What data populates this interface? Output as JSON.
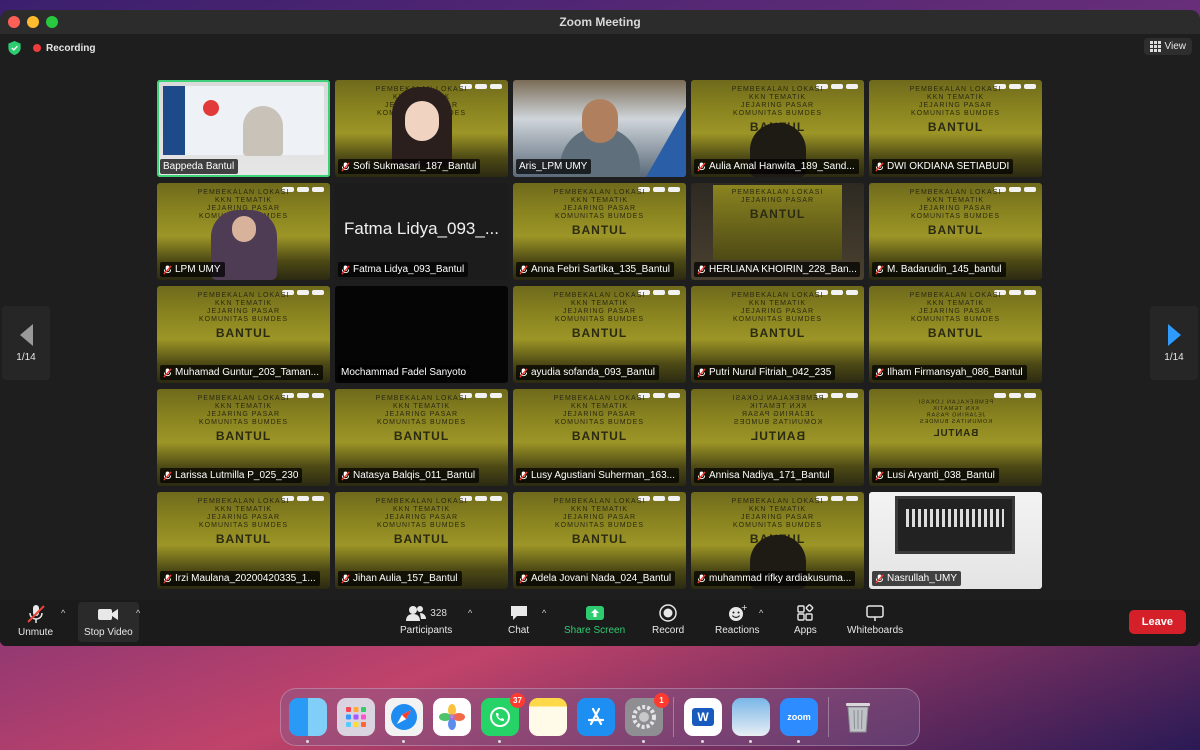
{
  "window": {
    "title": "Zoom Meeting"
  },
  "topbar": {
    "recording_label": "Recording",
    "view_label": "View"
  },
  "pagination": {
    "left": "1/14",
    "right": "1/14"
  },
  "tiles": [
    {
      "name": "Bappeda Bantul",
      "kind": "share",
      "active": true,
      "muted": false
    },
    {
      "name": "Sofi Sukmasari_187_Bantul",
      "kind": "person-slide",
      "muted": true
    },
    {
      "name": "Aris_LPM UMY",
      "kind": "person-b",
      "muted": false
    },
    {
      "name": "Aulia Amal Hanwita_189_Sand...",
      "kind": "person-slide-dark",
      "muted": true
    },
    {
      "name": "DWI OKDIANA SETIABUDI",
      "kind": "slide",
      "muted": true
    },
    {
      "name": "LPM UMY",
      "kind": "person-slide-hijab",
      "muted": true
    },
    {
      "name": "Fatma Lidya_093_Bantul",
      "kind": "blank",
      "bigname": "Fatma Lidya_093_...",
      "muted": true
    },
    {
      "name": "Anna Febri Sartika_135_Bantul",
      "kind": "slide",
      "muted": true
    },
    {
      "name": "HERLIANA KHOIRIN_228_Ban...",
      "kind": "photo-c",
      "muted": true
    },
    {
      "name": "M. Badarudin_145_bantul",
      "kind": "slide",
      "muted": true
    },
    {
      "name": "Muhamad Guntur_203_Taman...",
      "kind": "slide",
      "muted": true
    },
    {
      "name": "Mochammad Fadel Sanyoto",
      "kind": "black",
      "muted": false
    },
    {
      "name": "ayudia sofanda_093_Bantul",
      "kind": "slide",
      "muted": true
    },
    {
      "name": "Putri Nurul Fitriah_042_235",
      "kind": "slide",
      "muted": true
    },
    {
      "name": "Ilham Firmansyah_086_Bantul",
      "kind": "slide",
      "muted": true
    },
    {
      "name": "Larissa Lutmilla P_025_230",
      "kind": "slide",
      "muted": true
    },
    {
      "name": "Natasya Balqis_011_Bantul",
      "kind": "slide",
      "muted": true
    },
    {
      "name": "Lusy Agustiani Suherman_163...",
      "kind": "slide",
      "muted": true
    },
    {
      "name": "Annisa Nadiya_171_Bantul",
      "kind": "slide-mirror",
      "muted": true
    },
    {
      "name": "Lusi Aryanti_038_Bantul",
      "kind": "slide-mirror-small",
      "muted": true
    },
    {
      "name": "Irzi Maulana_20200420335_1...",
      "kind": "slide",
      "muted": true
    },
    {
      "name": "Jihan Aulia_157_Bantul",
      "kind": "slide",
      "muted": true
    },
    {
      "name": "Adela Jovani Nada_024_Bantul",
      "kind": "slide",
      "muted": true
    },
    {
      "name": "muhammad rifky ardiakusuma...",
      "kind": "person-slide-dark",
      "muted": true
    },
    {
      "name": "Nasrullah_UMY",
      "kind": "photo-d",
      "muted": true
    }
  ],
  "slide_text": {
    "line1": "PEMBEKALAN LOKASI",
    "line2": "KKN TEMATIK",
    "line3": "JEJARING PASAR",
    "line4": "KOMUNITAS BUMDES",
    "line5": "BANTUL"
  },
  "toolbar": {
    "unmute": "Unmute",
    "stop_video": "Stop Video",
    "participants": "Participants",
    "participants_count": "328",
    "chat": "Chat",
    "share_screen": "Share Screen",
    "record": "Record",
    "reactions": "Reactions",
    "apps": "Apps",
    "whiteboards": "Whiteboards",
    "leave": "Leave"
  },
  "dock": {
    "whatsapp_badge": "37",
    "settings_badge": "1",
    "zoom_label": "zoom",
    "word_label": "W"
  },
  "colors": {
    "accent_green": "#2ecc71",
    "leave_red": "#d5202a",
    "nav_blue": "#2e9bff",
    "active_tile_border": "#3fd07a"
  }
}
